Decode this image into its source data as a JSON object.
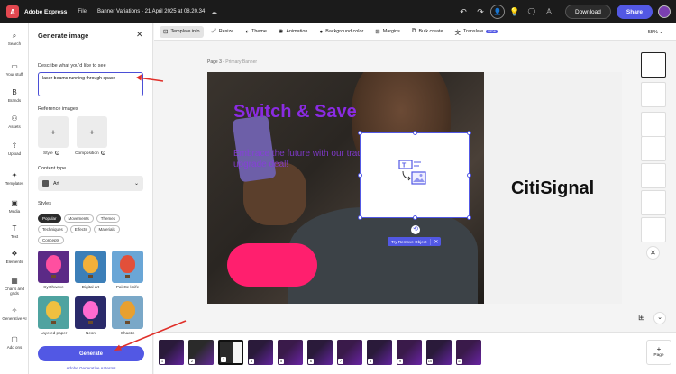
{
  "topbar": {
    "app_name": "Adobe Express",
    "menu_file": "File",
    "doc_title": "Banner Variations - 21 April 2025 at 08.20.34",
    "download_label": "Download",
    "share_label": "Share"
  },
  "rail": [
    {
      "label": "Search",
      "icon": "⌕"
    },
    {
      "label": "Your stuff",
      "icon": "▭"
    },
    {
      "label": "Brands",
      "icon": "B"
    },
    {
      "label": "Assets",
      "icon": "⚇"
    },
    {
      "label": "Upload",
      "icon": "⇪"
    },
    {
      "label": "Templates",
      "icon": "✦"
    },
    {
      "label": "Media",
      "icon": "▣"
    },
    {
      "label": "Text",
      "icon": "T"
    },
    {
      "label": "Elements",
      "icon": "❖"
    },
    {
      "label": "Charts and grids",
      "icon": "▦"
    },
    {
      "label": "Generative AI",
      "icon": "✧"
    },
    {
      "label": "Add ons",
      "icon": "▢"
    }
  ],
  "panel": {
    "title": "Generate image",
    "prompt_label": "Describe what you'd like to see",
    "prompt_value": "laser beams running through space",
    "reference_label": "Reference images",
    "style_cap": "Style",
    "composition_cap": "Composition",
    "content_type_label": "Content type",
    "content_type_value": "Art",
    "styles_label": "Styles",
    "style_tabs": [
      "Popular",
      "Movements",
      "Themes",
      "Techniques",
      "Effects",
      "Materials",
      "Concepts"
    ],
    "style_thumbs": [
      {
        "name": "Synthwave",
        "bg": "#5b2a86",
        "balloon": "#ff4fa0"
      },
      {
        "name": "Digital art",
        "bg": "#3c7fb8",
        "balloon": "#f2b03a"
      },
      {
        "name": "Palette knife",
        "bg": "#6aa6d6",
        "balloon": "#e2503a"
      },
      {
        "name": "Layered paper",
        "bg": "#4fa3a0",
        "balloon": "#f0c040"
      },
      {
        "name": "Neon",
        "bg": "#2a2a6a",
        "balloon": "#ff6ad0"
      },
      {
        "name": "Chaotic",
        "bg": "#7aa8c8",
        "balloon": "#e8a030"
      }
    ],
    "generate_label": "Generate",
    "terms_label": "Adobe Generative AI terms"
  },
  "toolbar": {
    "tools": [
      {
        "label": "Template info",
        "icon": "⊡"
      },
      {
        "label": "Resize",
        "icon": "⤢"
      },
      {
        "label": "Theme",
        "icon": "◐"
      },
      {
        "label": "Animation",
        "icon": "✺"
      },
      {
        "label": "Background color",
        "icon": "●"
      },
      {
        "label": "Margins",
        "icon": "⊞"
      },
      {
        "label": "Bulk create",
        "icon": "⧉"
      },
      {
        "label": "Translate",
        "icon": "文"
      }
    ],
    "new_badge": "NEW",
    "zoom": "55%"
  },
  "canvas": {
    "page_label": "Page 3 - ",
    "page_sub": "Primary Banner",
    "headline": "Switch & Save",
    "subline": "Embrace the future with our trade-in upgrade deal!",
    "brand": "CitiSignal",
    "try_remove_label": "Try Remove Object"
  },
  "filmstrip": {
    "pages": [
      "1",
      "2",
      "3",
      "4",
      "5",
      "6",
      "7",
      "8",
      "9",
      "10",
      "11"
    ],
    "add_page_label": "Page"
  },
  "colors": {
    "accent": "#5258e4",
    "headline": "#8a2be2",
    "pill": "#ff1f6e",
    "annotation_arrow": "#e0302a"
  }
}
